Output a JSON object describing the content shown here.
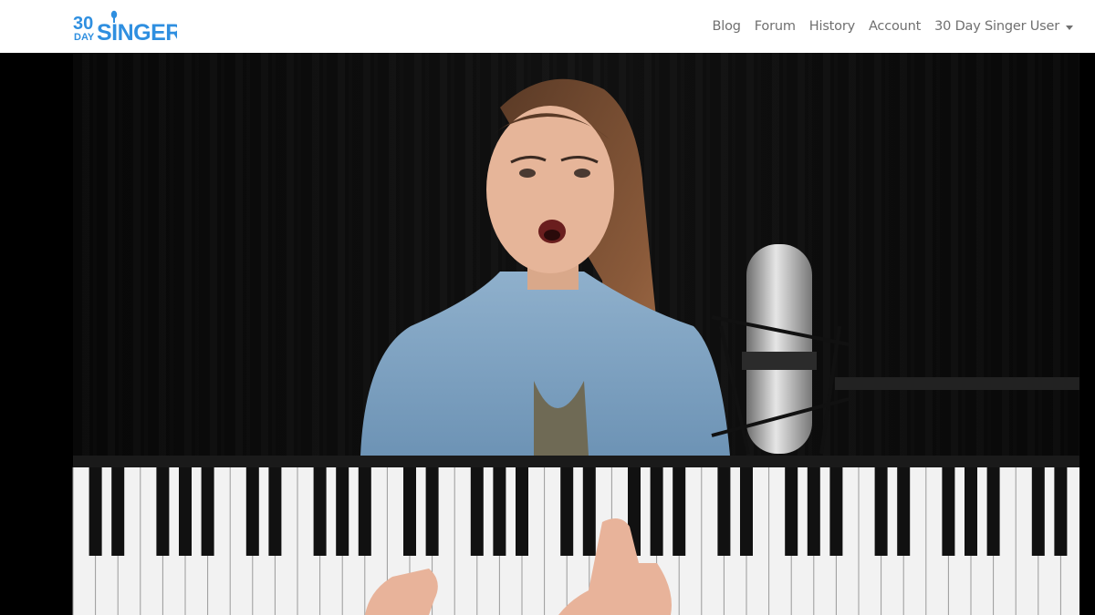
{
  "brand": {
    "logo_top": "30",
    "logo_sub": "DAY",
    "logo_main": "SINGER"
  },
  "nav": {
    "links": [
      "Blog",
      "Forum",
      "History",
      "Account"
    ],
    "user_label": "30 Day Singer User"
  },
  "colors": {
    "brand_blue": "#2f8fe0",
    "nav_text": "#707070"
  }
}
